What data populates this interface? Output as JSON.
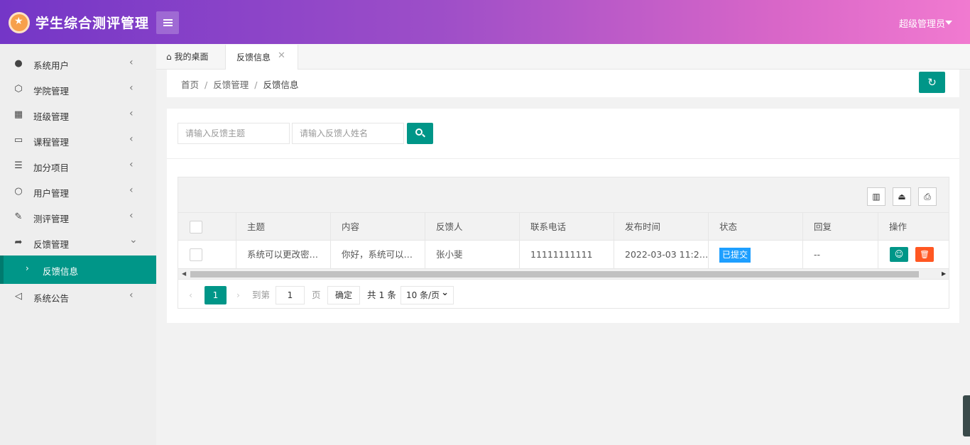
{
  "app": {
    "title": "学生综合测评管理",
    "user": "超级管理员"
  },
  "sidebar": {
    "items": [
      {
        "label": "系统用户",
        "icon": "user-icon"
      },
      {
        "label": "学院管理",
        "icon": "cube-icon"
      },
      {
        "label": "班级管理",
        "icon": "grid-icon"
      },
      {
        "label": "课程管理",
        "icon": "book-icon"
      },
      {
        "label": "加分项目",
        "icon": "list-icon"
      },
      {
        "label": "用户管理",
        "icon": "person-icon"
      },
      {
        "label": "测评管理",
        "icon": "edit-icon"
      },
      {
        "label": "反馈管理",
        "icon": "share-icon"
      },
      {
        "label": "系统公告",
        "icon": "speaker-icon"
      }
    ],
    "sub_item": "反馈信息"
  },
  "tabs": {
    "home": "我的桌面",
    "active": "反馈信息"
  },
  "breadcrumb": {
    "home": "首页",
    "section": "反馈管理",
    "current": "反馈信息",
    "separator": "/"
  },
  "search": {
    "topic_placeholder": "请输入反馈主题",
    "name_placeholder": "请输入反馈人姓名"
  },
  "table": {
    "columns": [
      "主题",
      "内容",
      "反馈人",
      "联系电话",
      "发布时间",
      "状态",
      "回复",
      "操作"
    ],
    "rows": [
      {
        "topic": "系统可以更改密…",
        "content": "你好，系统可以…",
        "person": "张小斐",
        "phone": "11111111111",
        "time": "2022-03-03 11:2…",
        "status": "已提交",
        "reply": "--"
      }
    ]
  },
  "pager": {
    "current": "1",
    "goto_label": "到第",
    "page_value": "1",
    "page_unit": "页",
    "confirm": "确定",
    "total": "共 1 条",
    "per_page": "10 条/页"
  },
  "colors": {
    "primary": "#009688",
    "danger": "#ff5722",
    "info": "#1e9fff"
  }
}
